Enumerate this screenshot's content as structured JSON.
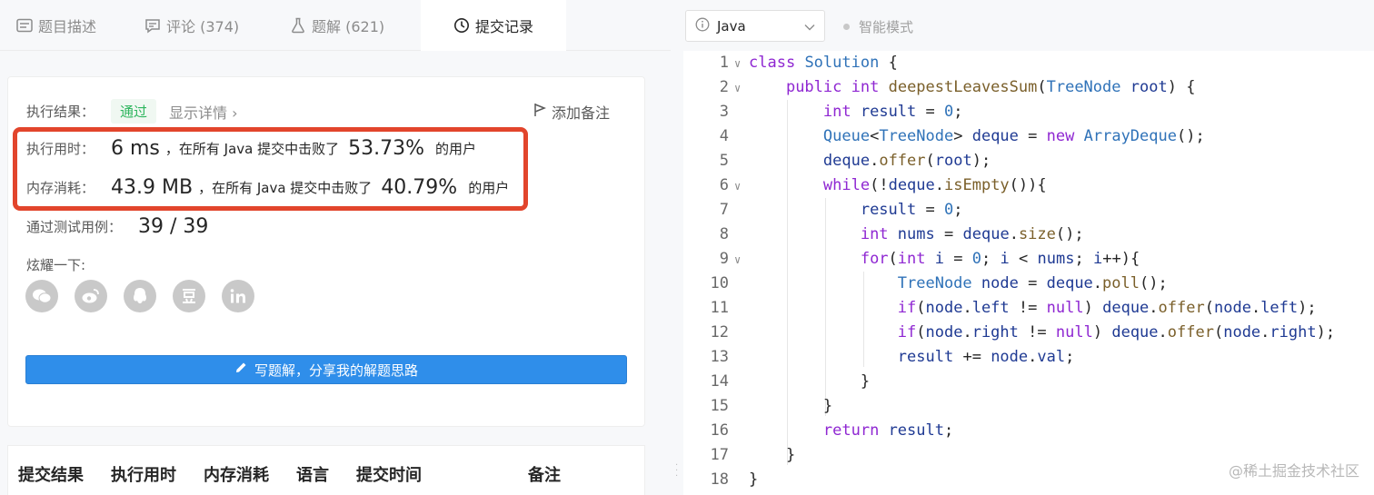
{
  "tabs": [
    {
      "label": "题目描述",
      "icon": "description-icon"
    },
    {
      "label": "评论 (374)",
      "icon": "comment-icon"
    },
    {
      "label": "题解 (621)",
      "icon": "flask-icon"
    },
    {
      "label": "提交记录",
      "icon": "clock-icon",
      "active": true
    }
  ],
  "result": {
    "label": "执行结果：",
    "status": "通过",
    "details": "显示详情 ›",
    "add_note": "添加备注"
  },
  "runtime": {
    "label": "执行用时：",
    "value": "6 ms",
    "text": "，在所有 Java 提交中击败了",
    "percent": "53.73%",
    "suffix": "的用户"
  },
  "memory": {
    "label": "内存消耗：",
    "value": "43.9 MB",
    "text": "，在所有 Java 提交中击败了",
    "percent": "40.79%",
    "suffix": "的用户"
  },
  "tests": {
    "label": "通过测试用例：",
    "value": "39 / 39"
  },
  "share": {
    "label": "炫耀一下:",
    "icons": [
      "wechat-icon",
      "weibo-icon",
      "qq-icon",
      "douban-icon",
      "linkedin-icon"
    ]
  },
  "write_solution": "写题解，分享我的解题思路",
  "table_headers": [
    "提交结果",
    "执行用时",
    "内存消耗",
    "语言",
    "提交时间",
    "备注"
  ],
  "editor": {
    "language": "Java",
    "smart_mode": "智能模式"
  },
  "code_lines": [
    "class Solution {",
    "    public int deepestLeavesSum(TreeNode root) {",
    "        int result = 0;",
    "        Queue<TreeNode> deque = new ArrayDeque();",
    "        deque.offer(root);",
    "        while(!deque.isEmpty()){",
    "            result = 0;",
    "            int nums = deque.size();",
    "            for(int i = 0; i < nums; i++){",
    "                TreeNode node = deque.poll();",
    "                if(node.left != null) deque.offer(node.left);",
    "                if(node.right != null) deque.offer(node.right);",
    "                result += node.val;",
    "            }",
    "        }",
    "        return result;",
    "    }",
    "}"
  ],
  "line_numbers": [
    "1",
    "2",
    "3",
    "4",
    "5",
    "6",
    "7",
    "8",
    "9",
    "10",
    "11",
    "12",
    "13",
    "14",
    "15",
    "16",
    "17",
    "18"
  ],
  "watermark": "@稀土掘金技术社区",
  "colors": {
    "accent": "#2f8eea",
    "pass": "#2db55d",
    "highlight_box": "#e2452c",
    "keyword": "#8f27d2",
    "type": "#2f72b8"
  }
}
